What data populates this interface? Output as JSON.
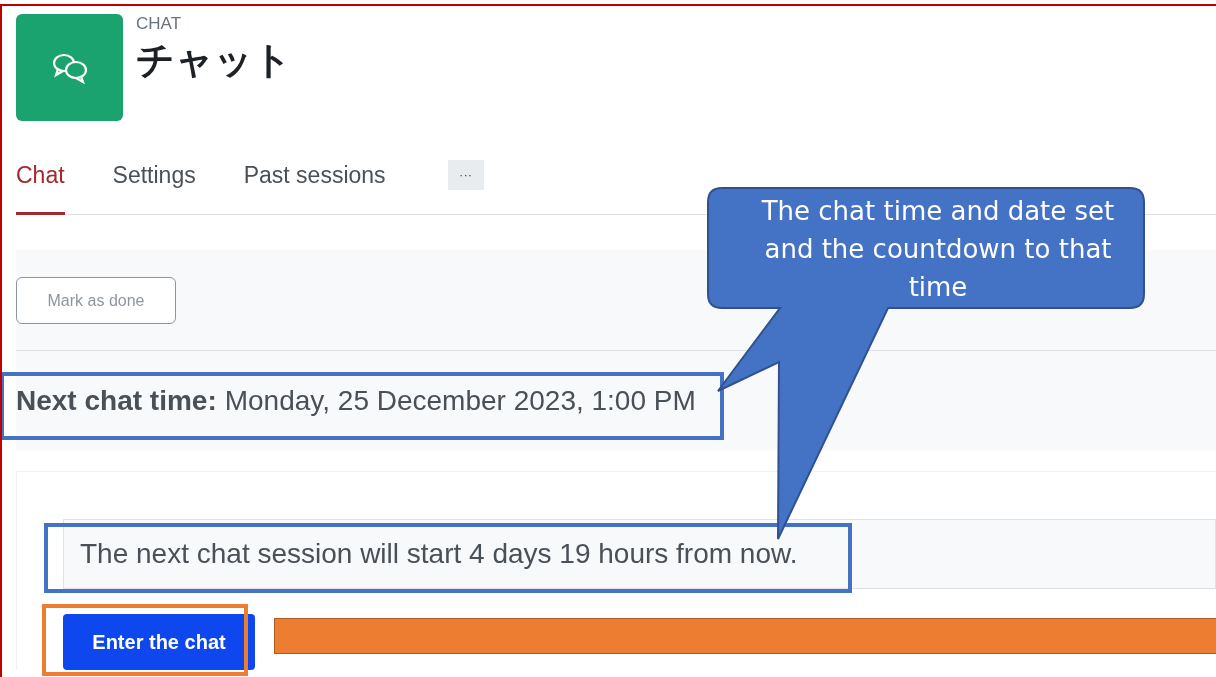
{
  "header": {
    "category": "CHAT",
    "title": "チャット"
  },
  "tabs": [
    {
      "label": "Chat",
      "selected": true
    },
    {
      "label": "Settings",
      "selected": false
    },
    {
      "label": "Past sessions",
      "selected": false
    }
  ],
  "more_tab": "···",
  "mark_done_button": "Mark as done",
  "next_chat": {
    "label": "Next chat time:",
    "value": "Monday, 25 December 2023, 1:00 PM"
  },
  "session_notice": "The next chat session will start 4 days 19 hours from now.",
  "enter_button": "Enter the chat",
  "annotations": {
    "callout": "The chat time and date set and the countdown to that time",
    "highlights": [
      {
        "color": "#4472c4"
      },
      {
        "color": "#4472c4"
      },
      {
        "color": "#ed7d31"
      }
    ],
    "cover_bar": {
      "color": "#ed7d31"
    }
  }
}
